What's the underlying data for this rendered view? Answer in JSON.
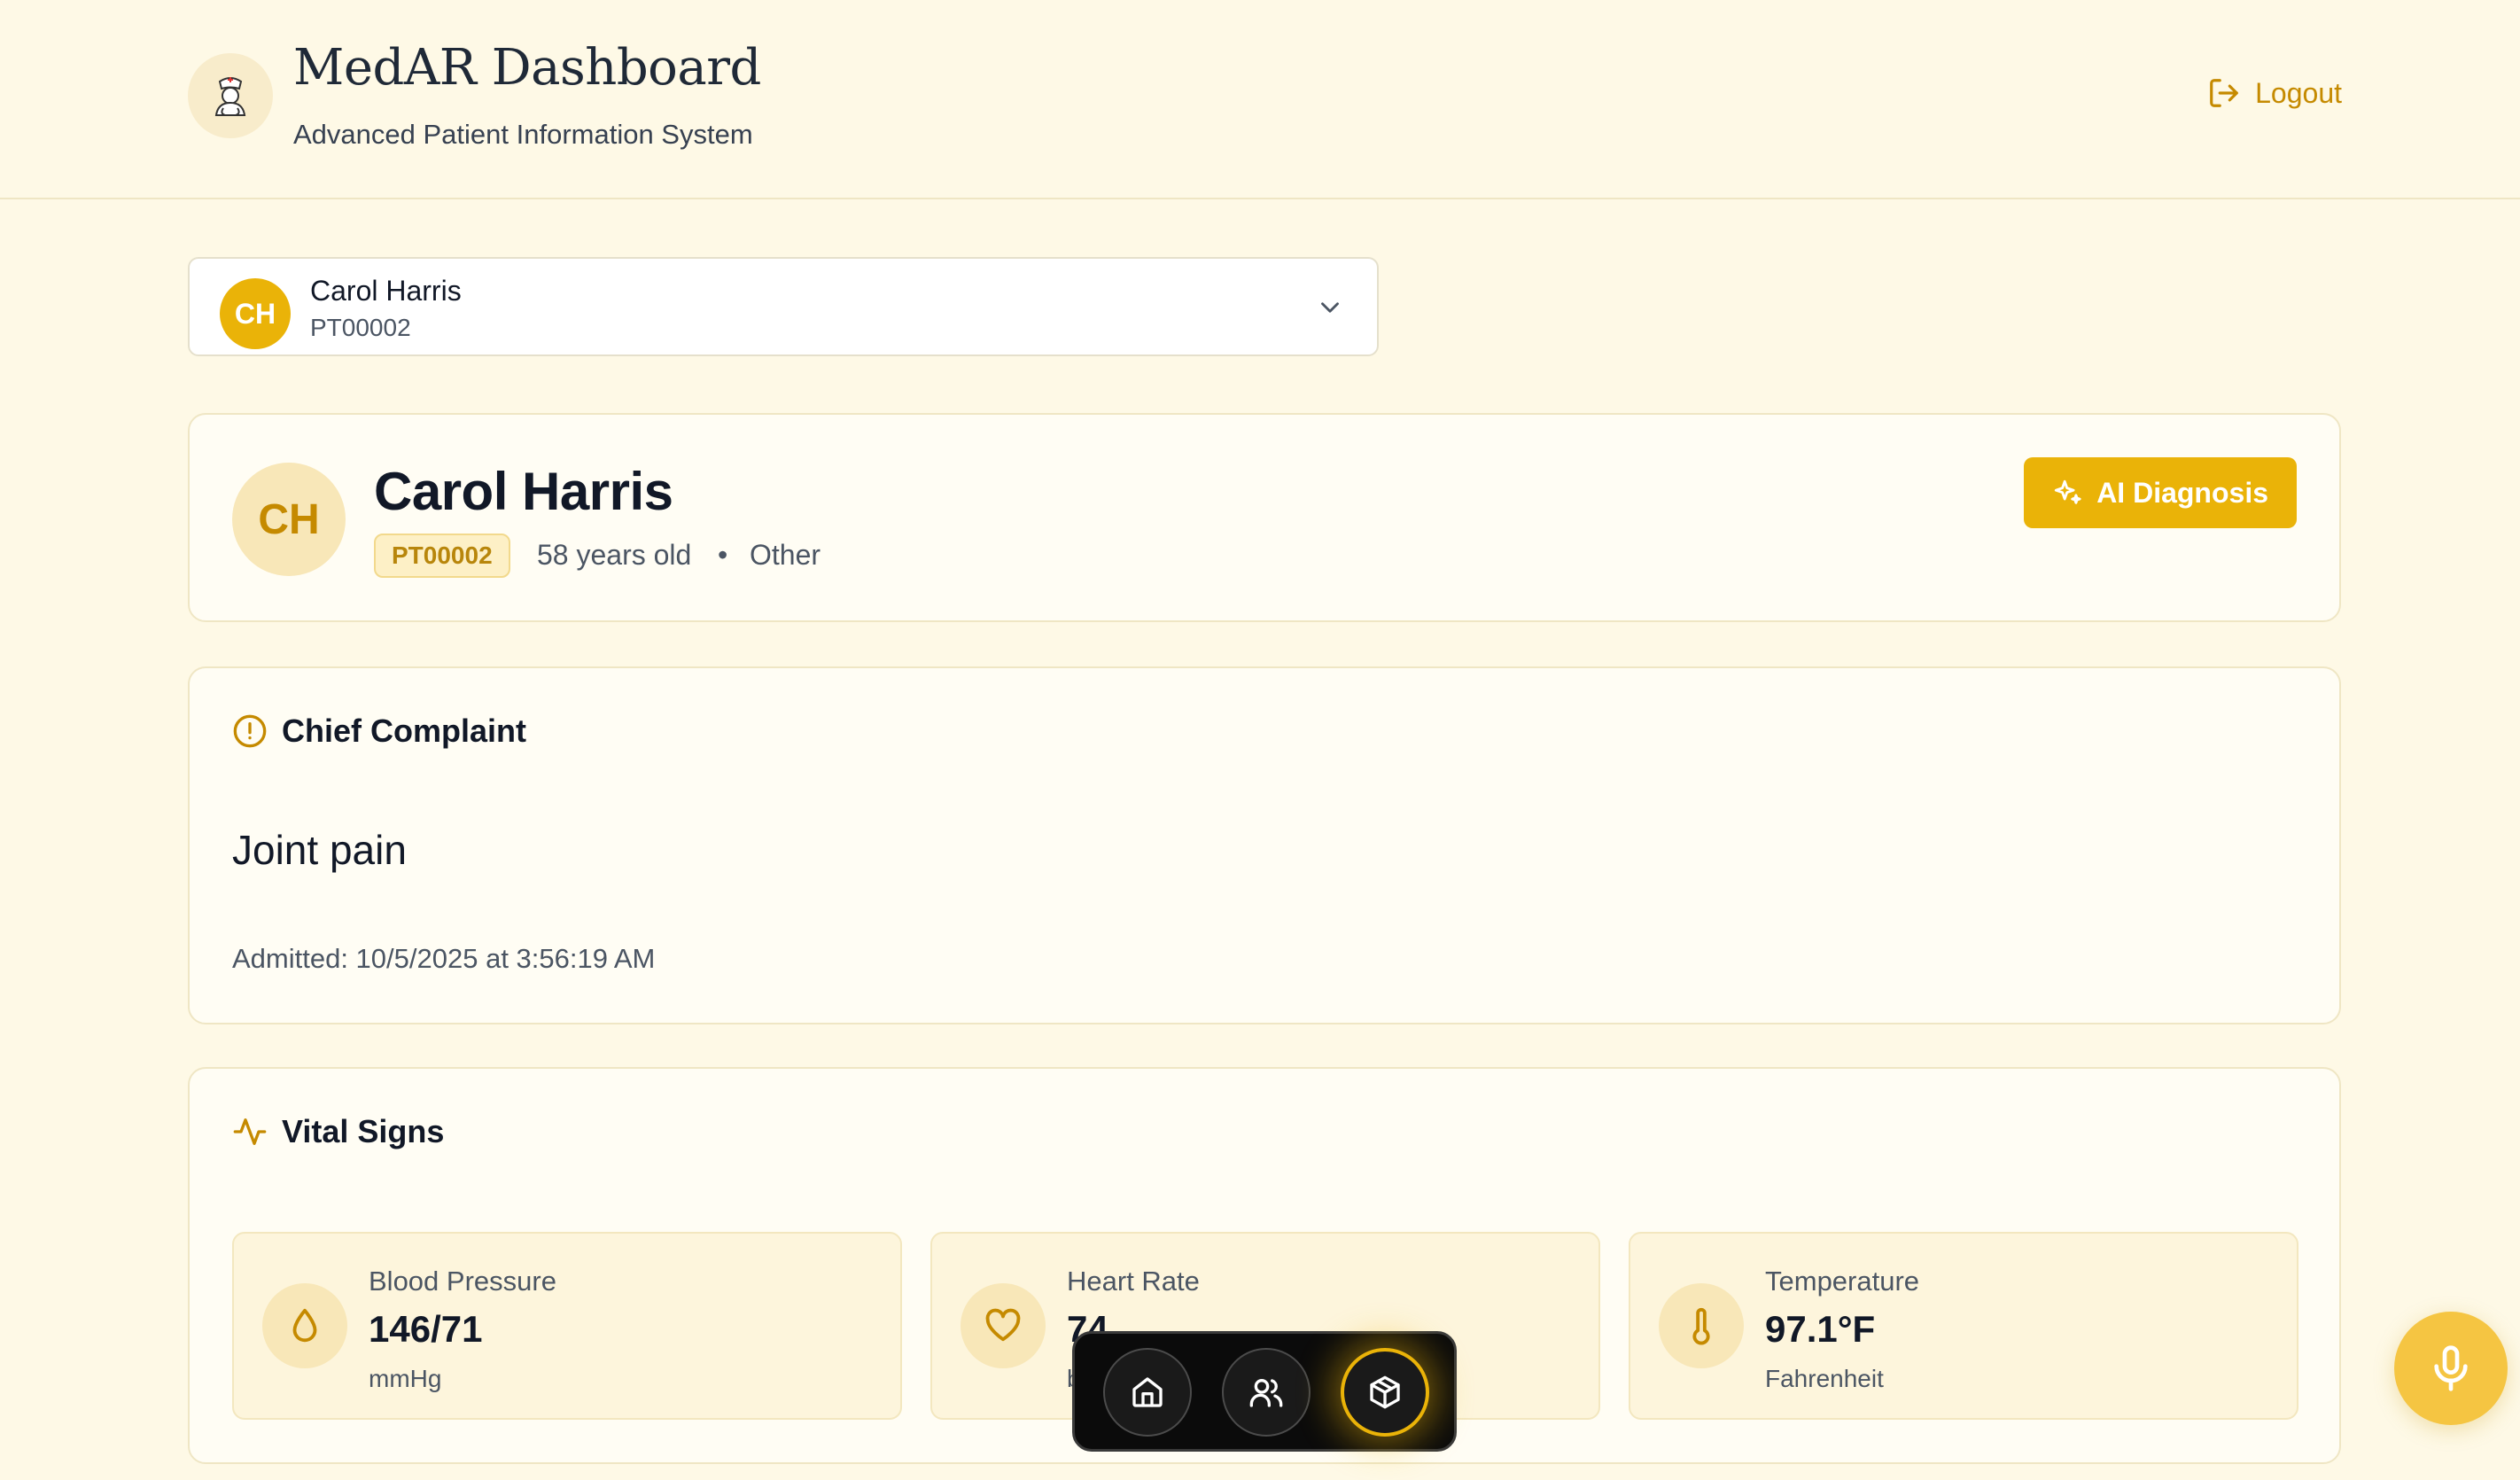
{
  "header": {
    "title": "MedAR Dashboard",
    "subtitle": "Advanced Patient Information System",
    "logout_label": "Logout"
  },
  "selector": {
    "initials": "CH",
    "name": "Carol Harris",
    "patient_id": "PT00002"
  },
  "patient": {
    "initials": "CH",
    "name": "Carol Harris",
    "patient_id": "PT00002",
    "age": "58 years old",
    "separator": "•",
    "gender": "Other",
    "ai_button_label": "AI Diagnosis"
  },
  "complaint": {
    "section_title": "Chief Complaint",
    "text": "Joint pain",
    "admitted": "Admitted: 10/5/2025 at 3:56:19 AM"
  },
  "vitals": {
    "section_title": "Vital Signs",
    "items": [
      {
        "label": "Blood Pressure",
        "value": "146/71",
        "unit": "mmHg",
        "icon": "droplet-icon"
      },
      {
        "label": "Heart Rate",
        "value": "74",
        "unit": "bpm",
        "icon": "heart-icon"
      },
      {
        "label": "Temperature",
        "value": "97.1°F",
        "unit": "Fahrenheit",
        "icon": "thermometer-icon"
      }
    ]
  },
  "dock": {
    "items": [
      "home-icon",
      "users-icon",
      "box-icon"
    ],
    "active": "box-icon"
  },
  "colors": {
    "accent": "#eab308",
    "accent_text": "#c58a00",
    "background": "#fef9e6"
  }
}
